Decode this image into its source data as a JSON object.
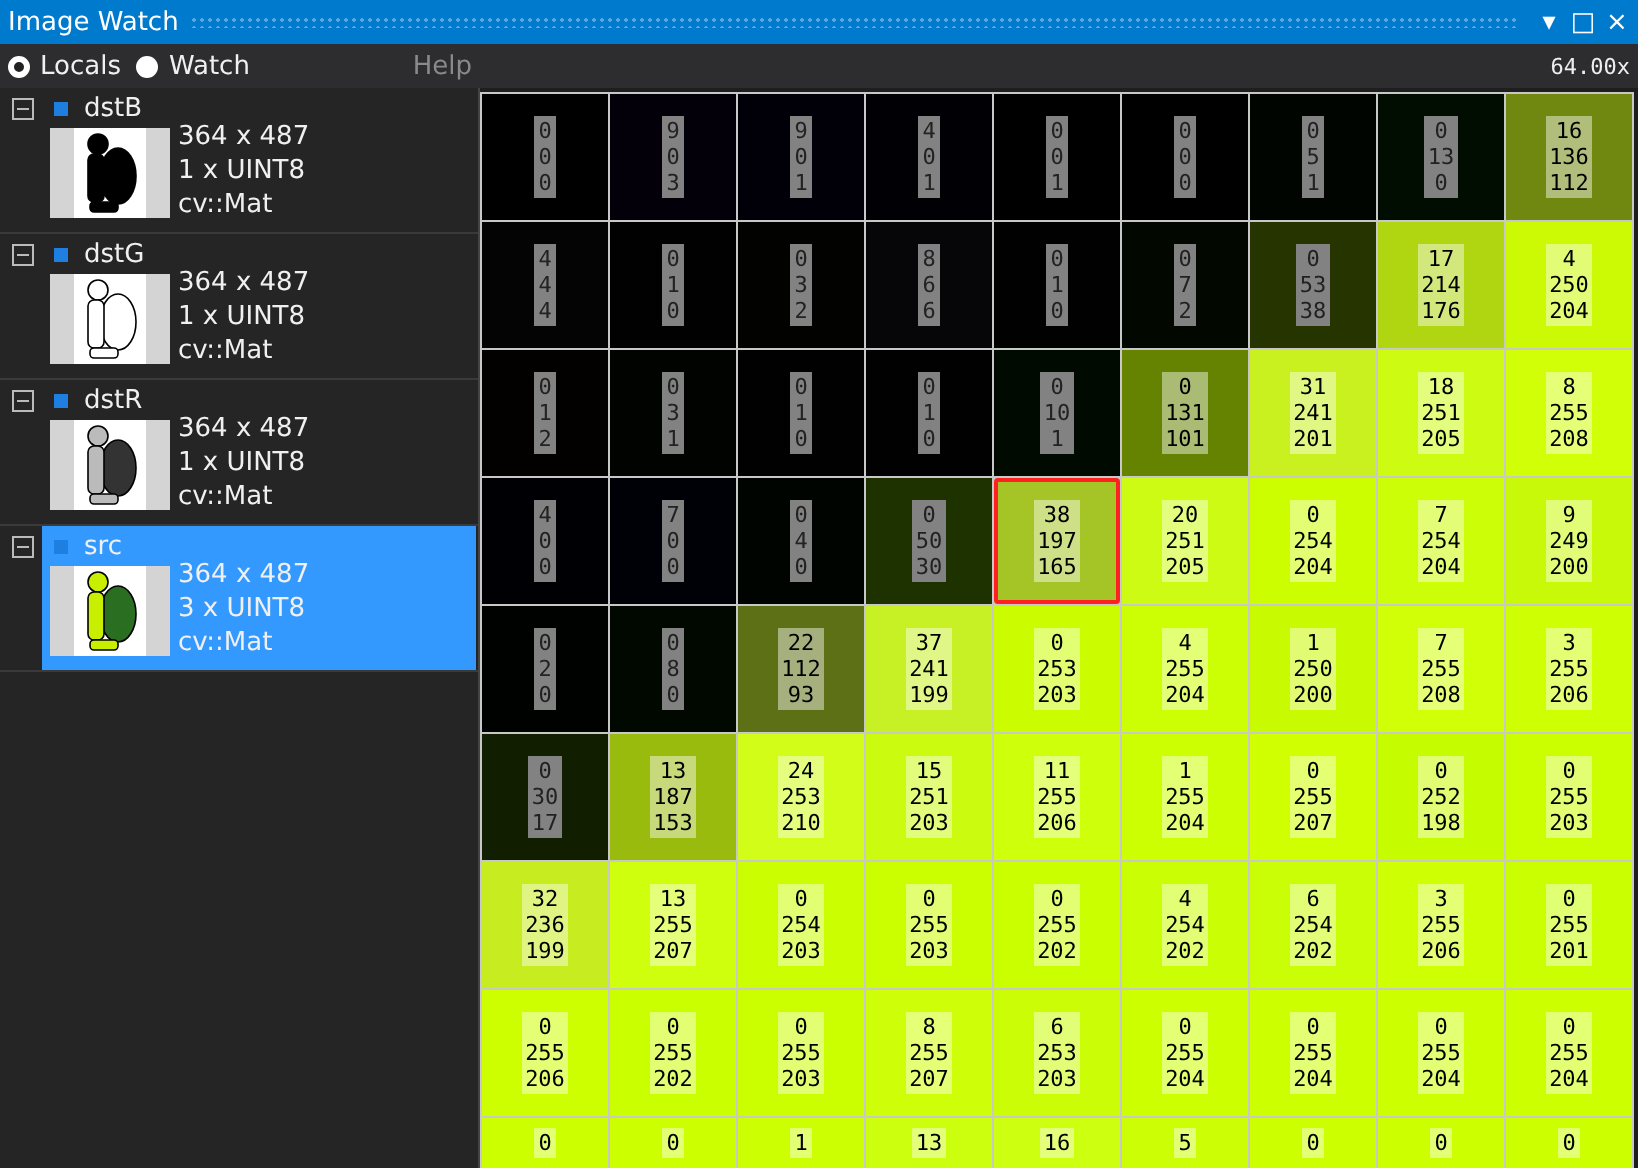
{
  "window": {
    "title": "Image Watch"
  },
  "title_buttons": [
    {
      "label": "▾"
    },
    {
      "label": "□"
    },
    {
      "label": "×"
    }
  ],
  "view_options": [
    {
      "label": "Locals",
      "selected": true
    },
    {
      "label": "Watch",
      "selected": false
    }
  ],
  "help": "Help",
  "zoom": "64.00x",
  "variables": [
    {
      "name": "dstB",
      "size": "364 x 487",
      "type": "1 x UINT8",
      "class": "cv::Mat",
      "expanded": true,
      "selected": false,
      "kind": "mono-dark"
    },
    {
      "name": "dstG",
      "size": "364 x 487",
      "type": "1 x UINT8",
      "class": "cv::Mat",
      "expanded": true,
      "selected": false,
      "kind": "mono-light"
    },
    {
      "name": "dstR",
      "size": "364 x 487",
      "type": "1 x UINT8",
      "class": "cv::Mat",
      "expanded": true,
      "selected": false,
      "kind": "mono-mid"
    },
    {
      "name": "src",
      "size": "364 x 487",
      "type": "3 x UINT8",
      "class": "cv::Mat",
      "expanded": true,
      "selected": true,
      "kind": "color"
    }
  ],
  "pixel_rows": [
    [
      {
        "values": [
          "0",
          "0",
          "0"
        ],
        "selected": false
      },
      {
        "values": [
          "9",
          "0",
          "3"
        ],
        "selected": false
      },
      {
        "values": [
          "9",
          "0",
          "1"
        ],
        "selected": false
      },
      {
        "values": [
          "4",
          "0",
          "1"
        ],
        "selected": false
      },
      {
        "values": [
          "0",
          "0",
          "1"
        ],
        "selected": false
      },
      {
        "values": [
          "0",
          "0",
          "0"
        ],
        "selected": false
      },
      {
        "values": [
          "0",
          "5",
          "1"
        ],
        "selected": false
      },
      {
        "values": [
          "0",
          "13",
          "0"
        ],
        "selected": false
      },
      {
        "values": [
          "16",
          "136",
          "112"
        ],
        "selected": false
      }
    ],
    [
      {
        "values": [
          "4",
          "4",
          "4"
        ],
        "selected": false
      },
      {
        "values": [
          "0",
          "1",
          "0"
        ],
        "selected": false
      },
      {
        "values": [
          "0",
          "3",
          "2"
        ],
        "selected": false
      },
      {
        "values": [
          "8",
          "6",
          "6"
        ],
        "selected": false
      },
      {
        "values": [
          "0",
          "1",
          "0"
        ],
        "selected": false
      },
      {
        "values": [
          "0",
          "7",
          "2"
        ],
        "selected": false
      },
      {
        "values": [
          "0",
          "53",
          "38"
        ],
        "selected": false
      },
      {
        "values": [
          "17",
          "214",
          "176"
        ],
        "selected": false
      },
      {
        "values": [
          "4",
          "250",
          "204"
        ],
        "selected": false
      }
    ],
    [
      {
        "values": [
          "0",
          "1",
          "2"
        ],
        "selected": false
      },
      {
        "values": [
          "0",
          "3",
          "1"
        ],
        "selected": false
      },
      {
        "values": [
          "0",
          "1",
          "0"
        ],
        "selected": false
      },
      {
        "values": [
          "0",
          "1",
          "0"
        ],
        "selected": false
      },
      {
        "values": [
          "0",
          "10",
          "1"
        ],
        "selected": false
      },
      {
        "values": [
          "0",
          "131",
          "101"
        ],
        "selected": false
      },
      {
        "values": [
          "31",
          "241",
          "201"
        ],
        "selected": false
      },
      {
        "values": [
          "18",
          "251",
          "205"
        ],
        "selected": false
      },
      {
        "values": [
          "8",
          "255",
          "208"
        ],
        "selected": false
      }
    ],
    [
      {
        "values": [
          "4",
          "0",
          "0"
        ],
        "selected": false
      },
      {
        "values": [
          "7",
          "0",
          "0"
        ],
        "selected": false
      },
      {
        "values": [
          "0",
          "4",
          "0"
        ],
        "selected": false
      },
      {
        "values": [
          "0",
          "50",
          "30"
        ],
        "selected": false
      },
      {
        "values": [
          "38",
          "197",
          "165"
        ],
        "selected": true
      },
      {
        "values": [
          "20",
          "251",
          "205"
        ],
        "selected": false
      },
      {
        "values": [
          "0",
          "254",
          "204"
        ],
        "selected": false
      },
      {
        "values": [
          "7",
          "254",
          "204"
        ],
        "selected": false
      },
      {
        "values": [
          "9",
          "249",
          "200"
        ],
        "selected": false
      }
    ],
    [
      {
        "values": [
          "0",
          "2",
          "0"
        ],
        "selected": false
      },
      {
        "values": [
          "0",
          "8",
          "0"
        ],
        "selected": false
      },
      {
        "values": [
          "22",
          "112",
          "93"
        ],
        "selected": false
      },
      {
        "values": [
          "37",
          "241",
          "199"
        ],
        "selected": false
      },
      {
        "values": [
          "0",
          "253",
          "203"
        ],
        "selected": false
      },
      {
        "values": [
          "4",
          "255",
          "204"
        ],
        "selected": false
      },
      {
        "values": [
          "1",
          "250",
          "200"
        ],
        "selected": false
      },
      {
        "values": [
          "7",
          "255",
          "208"
        ],
        "selected": false
      },
      {
        "values": [
          "3",
          "255",
          "206"
        ],
        "selected": false
      }
    ],
    [
      {
        "values": [
          "0",
          "30",
          "17"
        ],
        "selected": false
      },
      {
        "values": [
          "13",
          "187",
          "153"
        ],
        "selected": false
      },
      {
        "values": [
          "24",
          "253",
          "210"
        ],
        "selected": false
      },
      {
        "values": [
          "15",
          "251",
          "203"
        ],
        "selected": false
      },
      {
        "values": [
          "11",
          "255",
          "206"
        ],
        "selected": false
      },
      {
        "values": [
          "1",
          "255",
          "204"
        ],
        "selected": false
      },
      {
        "values": [
          "0",
          "255",
          "207"
        ],
        "selected": false
      },
      {
        "values": [
          "0",
          "252",
          "198"
        ],
        "selected": false
      },
      {
        "values": [
          "0",
          "255",
          "203"
        ],
        "selected": false
      }
    ],
    [
      {
        "values": [
          "32",
          "236",
          "199"
        ],
        "selected": false
      },
      {
        "values": [
          "13",
          "255",
          "207"
        ],
        "selected": false
      },
      {
        "values": [
          "0",
          "254",
          "203"
        ],
        "selected": false
      },
      {
        "values": [
          "0",
          "255",
          "203"
        ],
        "selected": false
      },
      {
        "values": [
          "0",
          "255",
          "202"
        ],
        "selected": false
      },
      {
        "values": [
          "4",
          "254",
          "202"
        ],
        "selected": false
      },
      {
        "values": [
          "6",
          "254",
          "202"
        ],
        "selected": false
      },
      {
        "values": [
          "3",
          "255",
          "206"
        ],
        "selected": false
      },
      {
        "values": [
          "0",
          "255",
          "201"
        ],
        "selected": false
      }
    ],
    [
      {
        "values": [
          "0",
          "255",
          "206"
        ],
        "selected": false
      },
      {
        "values": [
          "0",
          "255",
          "202"
        ],
        "selected": false
      },
      {
        "values": [
          "0",
          "255",
          "203"
        ],
        "selected": false
      },
      {
        "values": [
          "8",
          "255",
          "207"
        ],
        "selected": false
      },
      {
        "values": [
          "6",
          "253",
          "203"
        ],
        "selected": false
      },
      {
        "values": [
          "0",
          "255",
          "204"
        ],
        "selected": false
      },
      {
        "values": [
          "0",
          "255",
          "204"
        ],
        "selected": false
      },
      {
        "values": [
          "0",
          "255",
          "204"
        ],
        "selected": false
      },
      {
        "values": [
          "0",
          "255",
          "204"
        ],
        "selected": false
      }
    ],
    [
      {
        "values": [
          "0"
        ],
        "selected": false
      },
      {
        "values": [
          "0"
        ],
        "selected": false
      },
      {
        "values": [
          "1"
        ],
        "selected": false
      },
      {
        "values": [
          "13"
        ],
        "selected": false
      },
      {
        "values": [
          "16"
        ],
        "selected": false
      },
      {
        "values": [
          "5"
        ],
        "selected": false
      },
      {
        "values": [
          "0"
        ],
        "selected": false
      },
      {
        "values": [
          "0"
        ],
        "selected": false
      },
      {
        "values": [
          "0"
        ],
        "selected": false
      }
    ]
  ]
}
